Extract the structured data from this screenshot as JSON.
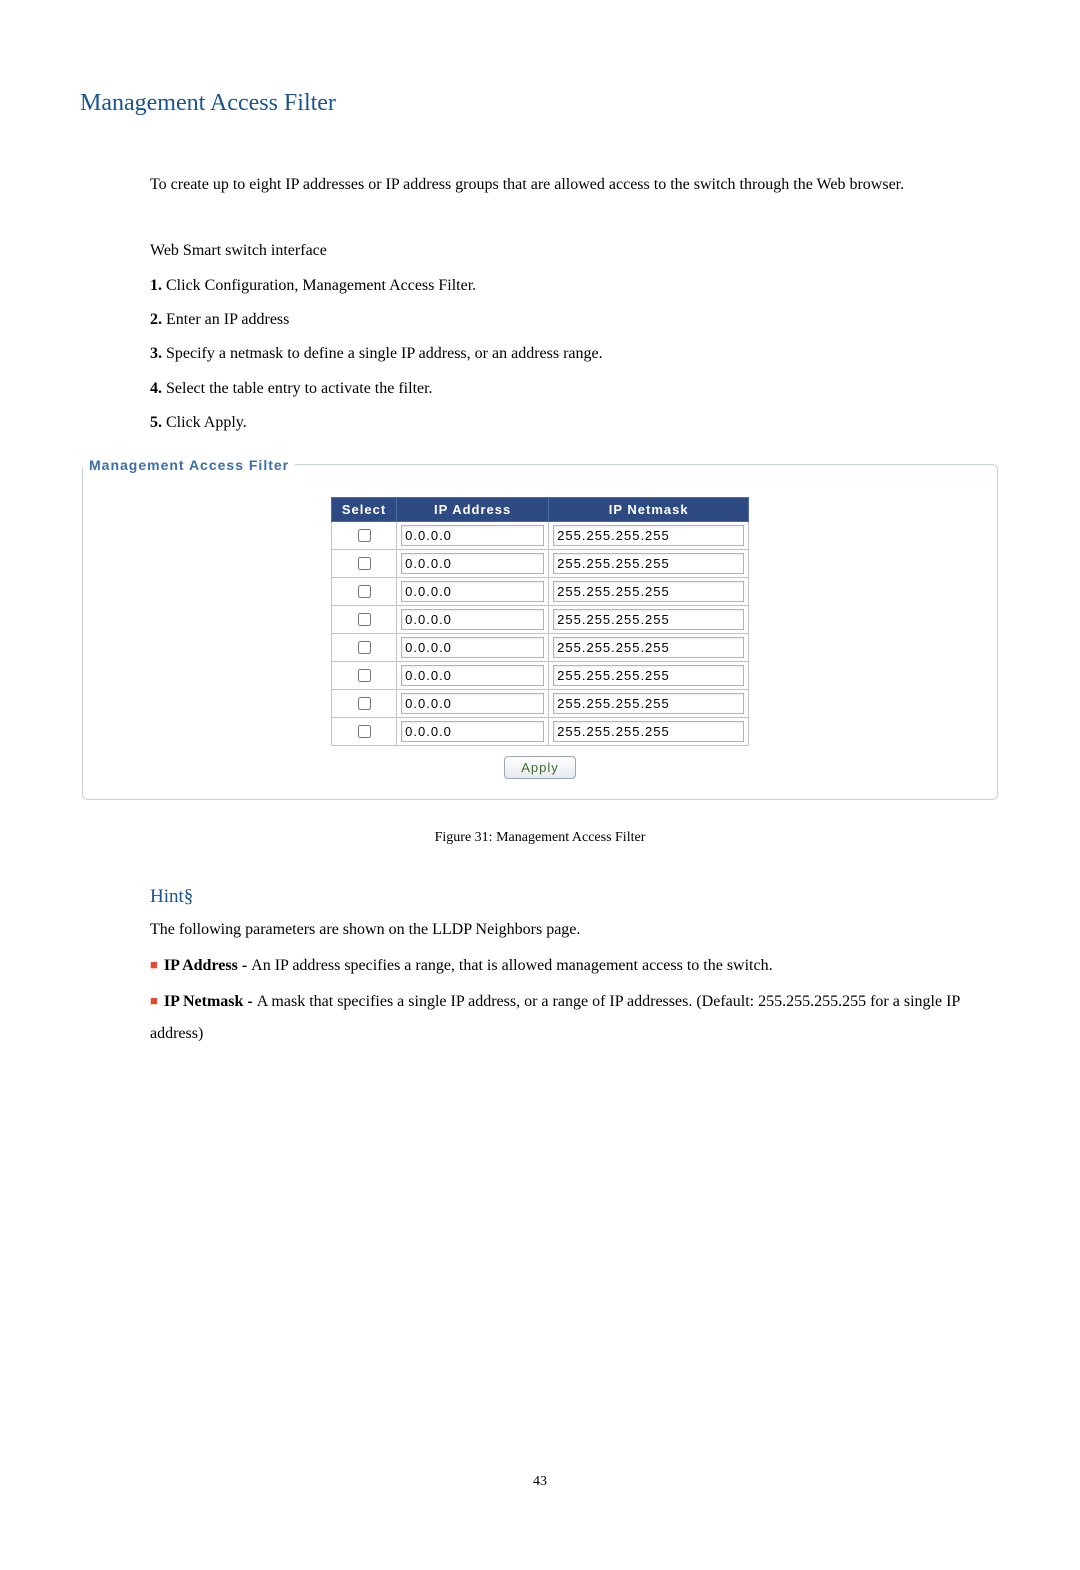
{
  "title": "Management Access Filter",
  "intro": "To create up to eight IP addresses or IP address groups that are allowed access to the switch through the Web browser.",
  "web_smart_label": "Web Smart switch interface",
  "steps": [
    {
      "num": "1.",
      "text": " Click Configuration, Management Access Filter."
    },
    {
      "num": "2.",
      "text": " Enter an IP address"
    },
    {
      "num": "3.",
      "text": " Specify a netmask to define a single IP address, or an address range."
    },
    {
      "num": "4.",
      "text": " Select the table entry to activate the filter."
    },
    {
      "num": "5.",
      "text": " Click Apply."
    }
  ],
  "fieldset": {
    "legend": "Management Access Filter",
    "headers": {
      "select": "Select",
      "ip": "IP Address",
      "mask": "IP Netmask"
    },
    "rows": [
      {
        "ip": "0.0.0.0",
        "mask": "255.255.255.255"
      },
      {
        "ip": "0.0.0.0",
        "mask": "255.255.255.255"
      },
      {
        "ip": "0.0.0.0",
        "mask": "255.255.255.255"
      },
      {
        "ip": "0.0.0.0",
        "mask": "255.255.255.255"
      },
      {
        "ip": "0.0.0.0",
        "mask": "255.255.255.255"
      },
      {
        "ip": "0.0.0.0",
        "mask": "255.255.255.255"
      },
      {
        "ip": "0.0.0.0",
        "mask": "255.255.255.255"
      },
      {
        "ip": "0.0.0.0",
        "mask": "255.255.255.255"
      }
    ],
    "apply_label": "Apply"
  },
  "figure_caption": "Figure 31: Management Access Filter",
  "hint": {
    "heading": "Hint§",
    "preface": "The following parameters are shown on the LLDP Neighbors page.",
    "items": [
      {
        "label": "IP Address - ",
        "text": "An IP address specifies a range, that is allowed management access to the switch."
      },
      {
        "label": "IP Netmask - ",
        "text": "A mask that specifies a single IP address, or a range of IP addresses. (Default: 255.255.255.255 for a single IP address)"
      }
    ]
  },
  "page_number": "43"
}
